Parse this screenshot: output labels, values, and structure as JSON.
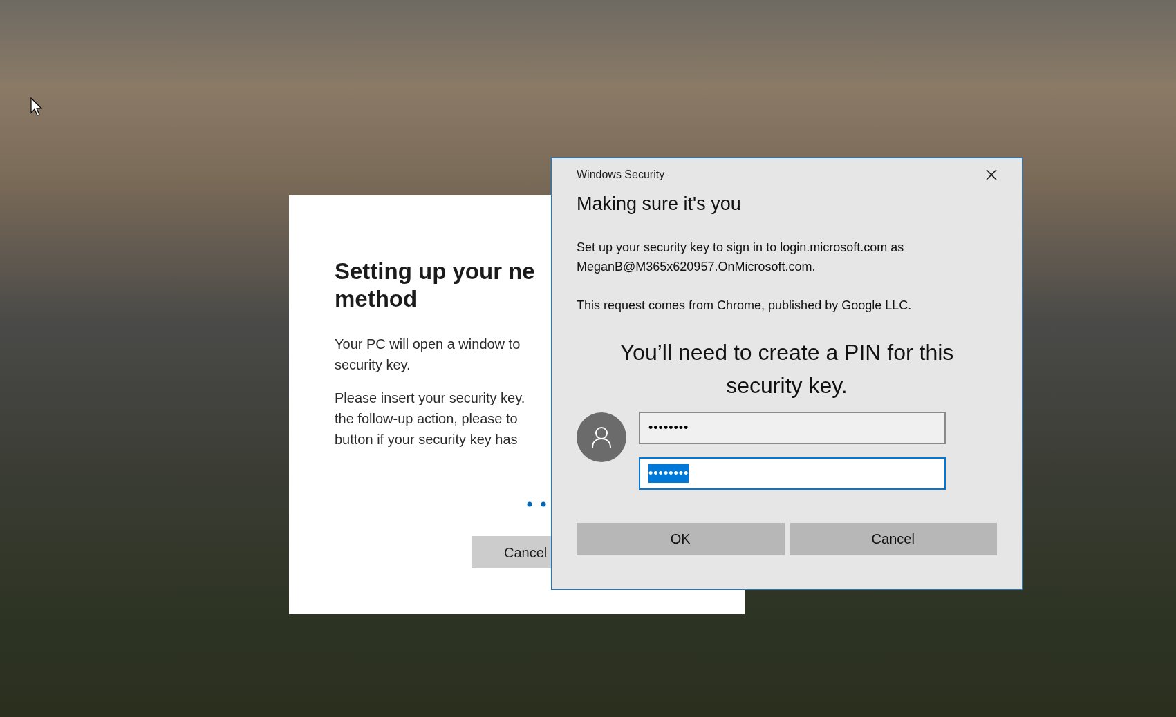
{
  "back_dialog": {
    "title_lines": [
      "Setting up your ne",
      "method"
    ],
    "paragraphs": [
      [
        "Your PC will open a window to",
        "security key."
      ],
      [
        "Please insert your security key.",
        "the follow-up action, please to",
        "button if your security key has"
      ]
    ],
    "cancel_button": "Cancel"
  },
  "security_dialog": {
    "window_title": "Windows Security",
    "heading": "Making sure it's you",
    "message": "Set up your security key to sign in to login.microsoft.com as MeganB@M365x620957.OnMicrosoft.com.",
    "source": "This request comes from Chrome, published by Google LLC.",
    "prompt": "You’ll need to create a PIN for this security key.",
    "pin_fields": [
      {
        "value": "••••••••",
        "focused": false
      },
      {
        "value": "••••••••",
        "focused": true
      }
    ],
    "buttons": [
      "OK",
      "Cancel"
    ]
  }
}
